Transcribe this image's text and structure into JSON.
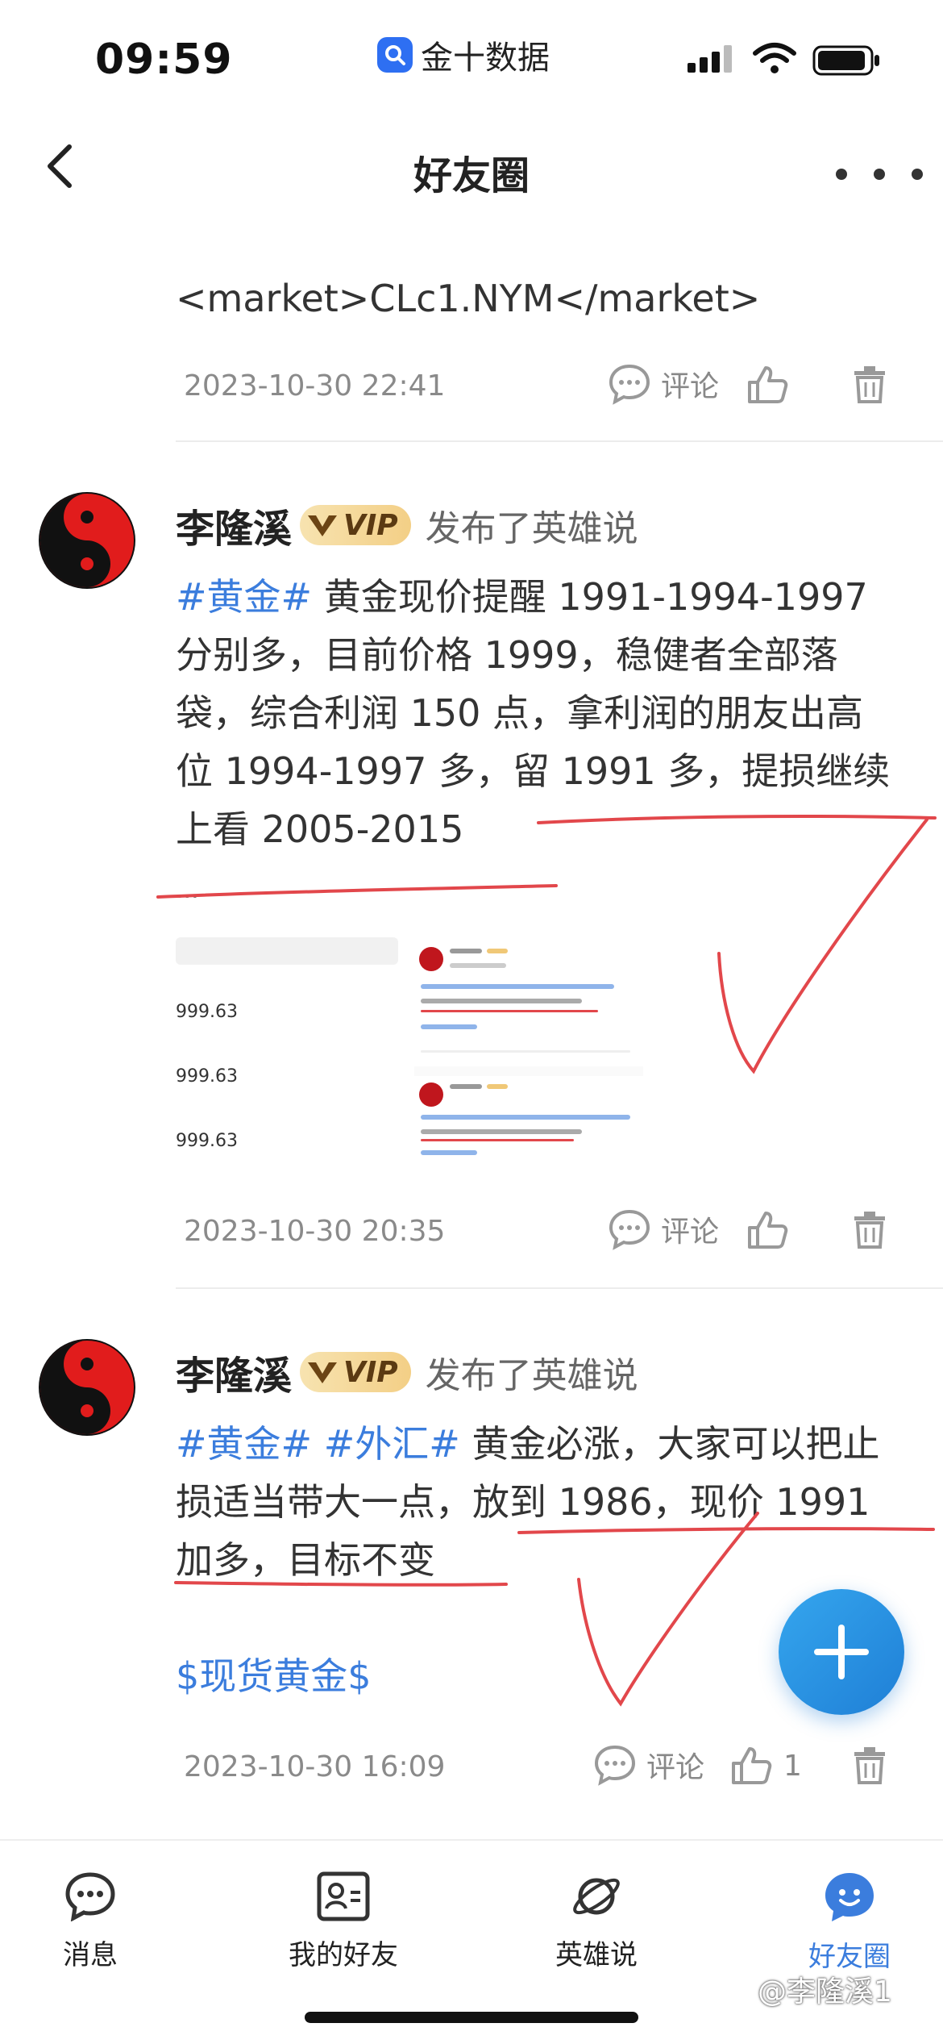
{
  "status_bar": {
    "time": "09:59",
    "app_name": "金十数据"
  },
  "nav": {
    "title": "好友圈"
  },
  "post0": {
    "text": "<market>CLc1.NYM</market>",
    "time": "2023-10-30 22:41",
    "comment_label": "评论"
  },
  "post1": {
    "user": "李隆溪",
    "vip": "VIP",
    "action": "发布了英雄说",
    "tag": "#黄金#",
    "lines": [
      "黄金现价提醒 1991-1994-1997",
      "分别多，目前价格 1999，稳健者全部落",
      "袋，综合利润 150 点，拿利润的朋友出高",
      "位 1994-1997 多，留 1991 多，提损继续",
      "上看 2005-2015"
    ],
    "ellipsis": "...",
    "thumb_prices": [
      "999.63",
      "999.63",
      "999.63"
    ],
    "time": "2023-10-30 20:35",
    "comment_label": "评论"
  },
  "post2": {
    "user": "李隆溪",
    "vip": "VIP",
    "action": "发布了英雄说",
    "tag1": "#黄金#",
    "tag2": "#外汇#",
    "line1": "黄金必涨，大家可以把止",
    "line2": "损适当带大一点，放到 1986，现价 1991",
    "line3": "加多，目标不变",
    "symbol": "$现货黄金$",
    "time": "2023-10-30 16:09",
    "comment_label": "评论",
    "like_count": "1"
  },
  "tabs": [
    {
      "label": "消息",
      "icon": "message-icon"
    },
    {
      "label": "我的好友",
      "icon": "contact-card-icon"
    },
    {
      "label": "英雄说",
      "icon": "planet-icon"
    },
    {
      "label": "好友圈",
      "icon": "smile-bubble-icon"
    }
  ],
  "watermark": "@李隆溪1",
  "colors": {
    "accent": "#3b7ddd",
    "annotation_red": "#e2474b"
  }
}
